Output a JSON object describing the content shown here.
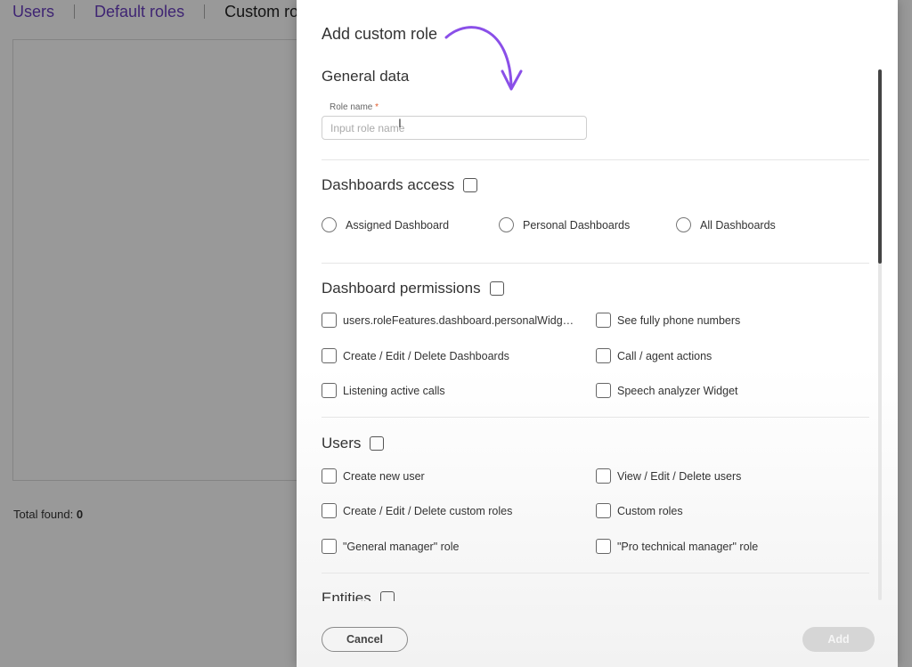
{
  "background": {
    "tabs": [
      {
        "label": "Users"
      },
      {
        "label": "Default roles"
      },
      {
        "label": "Custom ro"
      }
    ],
    "total_label": "Total found:",
    "total_value": "0"
  },
  "modal": {
    "title": "Add custom role",
    "general": {
      "title": "General data",
      "role_name_label": "Role name",
      "required_mark": "*",
      "role_name_placeholder": "Input role name",
      "role_name_value": ""
    },
    "dashboards_access": {
      "title": "Dashboards access",
      "options": [
        {
          "label": "Assigned Dashboard"
        },
        {
          "label": "Personal Dashboards"
        },
        {
          "label": "All Dashboards"
        }
      ]
    },
    "dashboard_permissions": {
      "title": "Dashboard permissions",
      "items": [
        {
          "label": "users.roleFeatures.dashboard.personalWidgets"
        },
        {
          "label": "See fully phone numbers"
        },
        {
          "label": "Create / Edit / Delete Dashboards"
        },
        {
          "label": "Call / agent actions"
        },
        {
          "label": "Listening active calls"
        },
        {
          "label": "Speech analyzer Widget"
        }
      ]
    },
    "users": {
      "title": "Users",
      "items": [
        {
          "label": "Create new user"
        },
        {
          "label": "View / Edit / Delete users"
        },
        {
          "label": "Create / Edit / Delete custom roles"
        },
        {
          "label": "Custom roles"
        },
        {
          "label": "\"General manager\" role"
        },
        {
          "label": "\"Pro technical manager\" role"
        }
      ]
    },
    "entities": {
      "title": "Entities"
    },
    "cancel_label": "Cancel",
    "add_label": "Add"
  },
  "colors": {
    "accent_link": "#6a3fc0",
    "annotation_arrow": "#8a4fe8",
    "add_button_disabled": "#d6d6d6"
  }
}
